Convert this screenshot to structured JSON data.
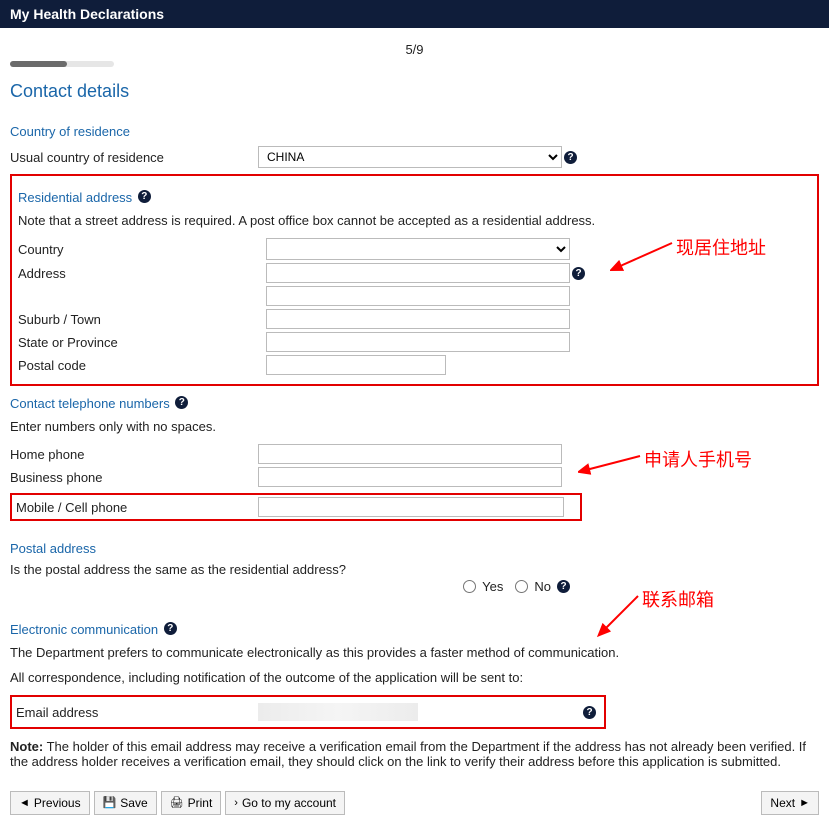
{
  "header": {
    "title": "My Health Declarations"
  },
  "progress": {
    "label": "5/9",
    "percent": 55
  },
  "sections": {
    "contact_details": "Contact details",
    "country_of_residence": {
      "heading": "Country of residence",
      "label": "Usual country of residence",
      "value": "CHINA"
    },
    "residential_address": {
      "heading": "Residential address",
      "note": "Note that a street address is required. A post office box cannot be accepted as a residential address.",
      "country_label": "Country",
      "country_value": "",
      "address_label": "Address",
      "address_value1": "",
      "address_value2": "",
      "suburb_label": "Suburb / Town",
      "suburb_value": "",
      "state_label": "State or Province",
      "state_value": "",
      "postal_label": "Postal code",
      "postal_value": ""
    },
    "telephone": {
      "heading": "Contact telephone numbers",
      "note": "Enter numbers only with no spaces.",
      "home_label": "Home phone",
      "home_value": "",
      "business_label": "Business phone",
      "business_value": "",
      "mobile_label": "Mobile / Cell phone",
      "mobile_value": ""
    },
    "postal_address": {
      "heading": "Postal address",
      "question": "Is the postal address the same as the residential address?",
      "yes": "Yes",
      "no": "No"
    },
    "electronic": {
      "heading": "Electronic communication",
      "line1": "The Department prefers to communicate electronically as this provides a faster method of communication.",
      "line2": "All correspondence, including notification of the outcome of the application will be sent to:",
      "email_label": "Email address",
      "note_label": "Note:",
      "note_body": " The holder of this email address may receive a verification email from the Department if the address has not already been verified. If the address holder receives a verification email, they should click on the link to verify their address before this application is submitted."
    }
  },
  "annotations": {
    "addr": "现居住地址",
    "mobile": "申请人手机号",
    "email": "联系邮箱"
  },
  "footer": {
    "previous": "Previous",
    "save": "Save",
    "print": "Print",
    "account": "Go to my account",
    "next": "Next"
  }
}
